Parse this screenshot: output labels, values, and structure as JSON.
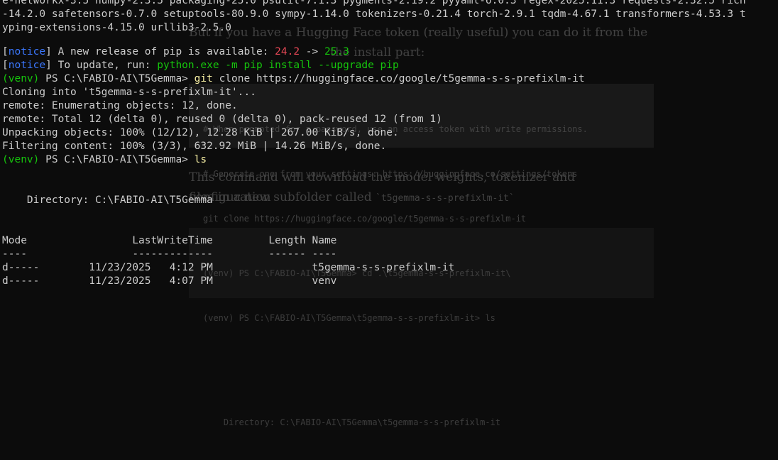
{
  "ghost": {
    "para1": "But if you have a Hugging Face token (really useful) you can do it from the",
    "para1b": "the install part:",
    "box_light": [
      "# When prompted for a password, use an access token with write permissions.",
      "# Generate one from your settings: https://huggingface.co/settings/tokens",
      "git clone https://huggingface.co/google/t5gemma-s-s-prefixlm-it"
    ],
    "para2": "This command will download the model weights, tokenizer and configuration",
    "para2b": "files in a new subfolder called ",
    "para2_code": "`t5gemma-s-s-prefixlm-it`",
    "box_dark": [
      "(venv) PS C:\\FABIO-AI\\T5Gemma> cd .\\t5gemma-s-s-prefixlm-it\\",
      "(venv) PS C:\\FABIO-AI\\T5Gemma\\t5gemma-s-s-prefixlm-it> ls",
      "",
      "",
      "    Directory: C:\\FABIO-AI\\T5Gemma\\t5gemma-s-s-prefixlm-it"
    ]
  },
  "terminal": {
    "line1": "e-networkx-3.5 numpy-2.3.5 packaging-25.0 psutil-7.1.3 pygments-2.19.2 pyyaml-6.0.3 regex-2025.11.3 requests-2.32.5 rich",
    "line2": "-14.2.0 safetensors-0.7.0 setuptools-80.9.0 sympy-1.14.0 tokenizers-0.21.4 torch-2.9.1 tqdm-4.67.1 transformers-4.53.3 t",
    "line3": "yping-extensions-4.15.0 urllib3-2.5.0",
    "notice_word": "notice",
    "notice1_text": " A new release of pip is available: ",
    "pip_old": "24.2",
    "arrow": " -> ",
    "pip_new": "25.3",
    "notice2_text": " To update, run: ",
    "pip_upgrade_cmd": "python.exe -m pip install --upgrade pip",
    "venv": "(venv)",
    "prompt_path": " PS C:\\FABIO-AI\\T5Gemma> ",
    "git_cmd": "git",
    "git_args": " clone https://huggingface.co/google/t5gemma-s-s-prefixlm-it",
    "cloning": "Cloning into 't5gemma-s-s-prefixlm-it'...",
    "remote_enum": "remote: Enumerating objects: 12, done.",
    "remote_total": "remote: Total 12 (delta 0), reused 0 (delta 0), pack-reused 12 (from 1)",
    "unpacking": "Unpacking objects: 100% (12/12), 12.28 KiB | 267.00 KiB/s, done.",
    "filtering": "Filtering content: 100% (3/3), 632.92 MiB | 14.26 MiB/s, done.",
    "ls_cmd": "ls",
    "directory_line": "    Directory: C:\\FABIO-AI\\T5Gemma",
    "header_row": "Mode                 LastWriteTime         Length Name",
    "underline_row": "----                 -------------         ------ ----",
    "rows": [
      "d-----        11/23/2025   4:12 PM                t5gemma-s-s-prefixlm-it",
      "d-----        11/23/2025   4:07 PM                venv"
    ]
  }
}
